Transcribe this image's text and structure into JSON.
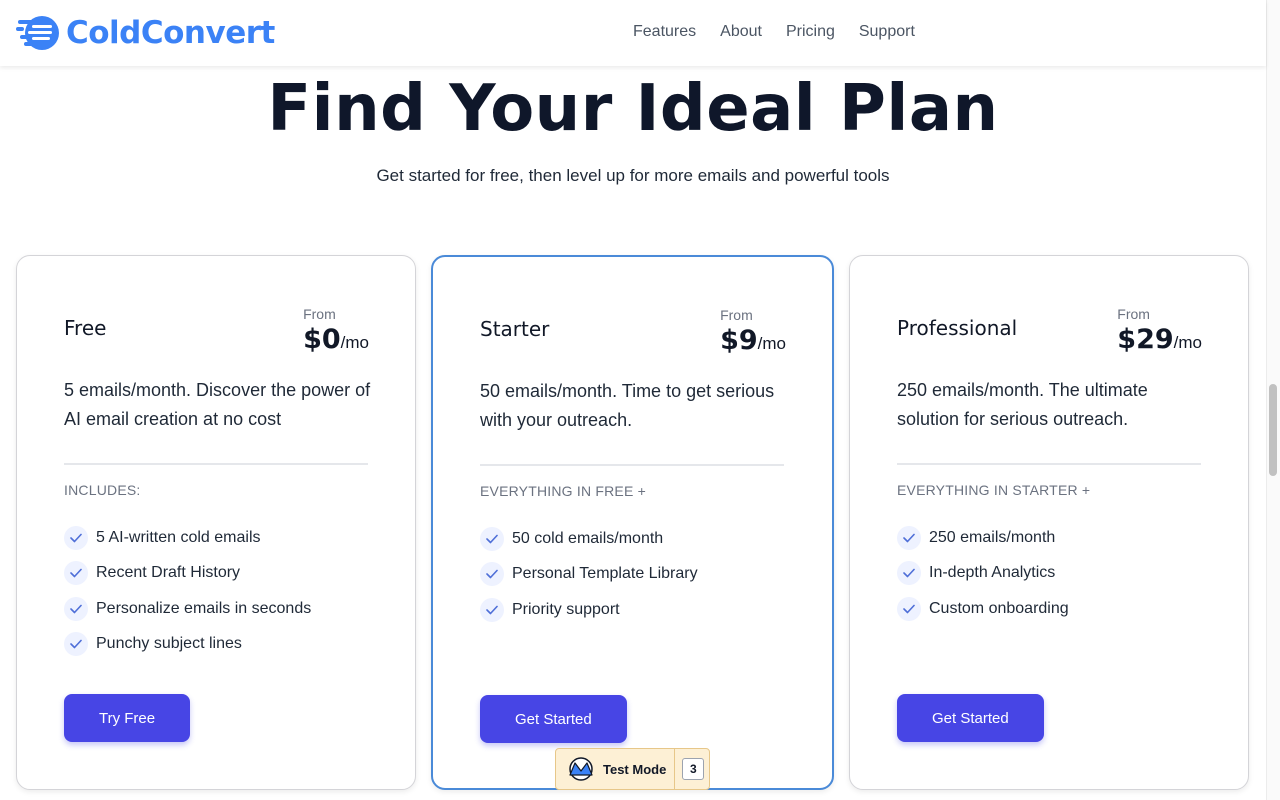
{
  "brand": {
    "name": "ColdConvert",
    "accent": "#3b82f6",
    "button_color": "#4745e5"
  },
  "nav": {
    "items": [
      "Features",
      "About",
      "Pricing",
      "Support"
    ]
  },
  "hero": {
    "title": "Find Your Ideal Plan",
    "subtitle": "Get started for free, then level up for more emails and powerful tools"
  },
  "plans": [
    {
      "name": "Free",
      "from": "From",
      "price": "$0",
      "unit": "/mo",
      "description": "5 emails/month. Discover the power of AI email creation at no cost",
      "includes": "INCLUDES:",
      "features": [
        "5 AI-written cold emails",
        "Recent Draft History",
        "Personalize emails in seconds",
        "Punchy subject lines"
      ],
      "cta": "Try Free"
    },
    {
      "name": "Starter",
      "from": "From",
      "price": "$9",
      "unit": "/mo",
      "description": "50 emails/month. Time to get serious with your outreach.",
      "includes": "EVERYTHING IN FREE +",
      "features": [
        "50 cold emails/month",
        "Personal Template Library",
        "Priority support"
      ],
      "cta": "Get Started"
    },
    {
      "name": "Professional",
      "from": "From",
      "price": "$29",
      "unit": "/mo",
      "description": "250 emails/month. The ultimate solution for serious outreach.",
      "includes": "EVERYTHING IN STARTER +",
      "features": [
        "250 emails/month",
        "In-depth Analytics",
        "Custom onboarding"
      ],
      "cta": "Get Started"
    }
  ],
  "test_mode": {
    "label": "Test Mode",
    "count": "3"
  }
}
